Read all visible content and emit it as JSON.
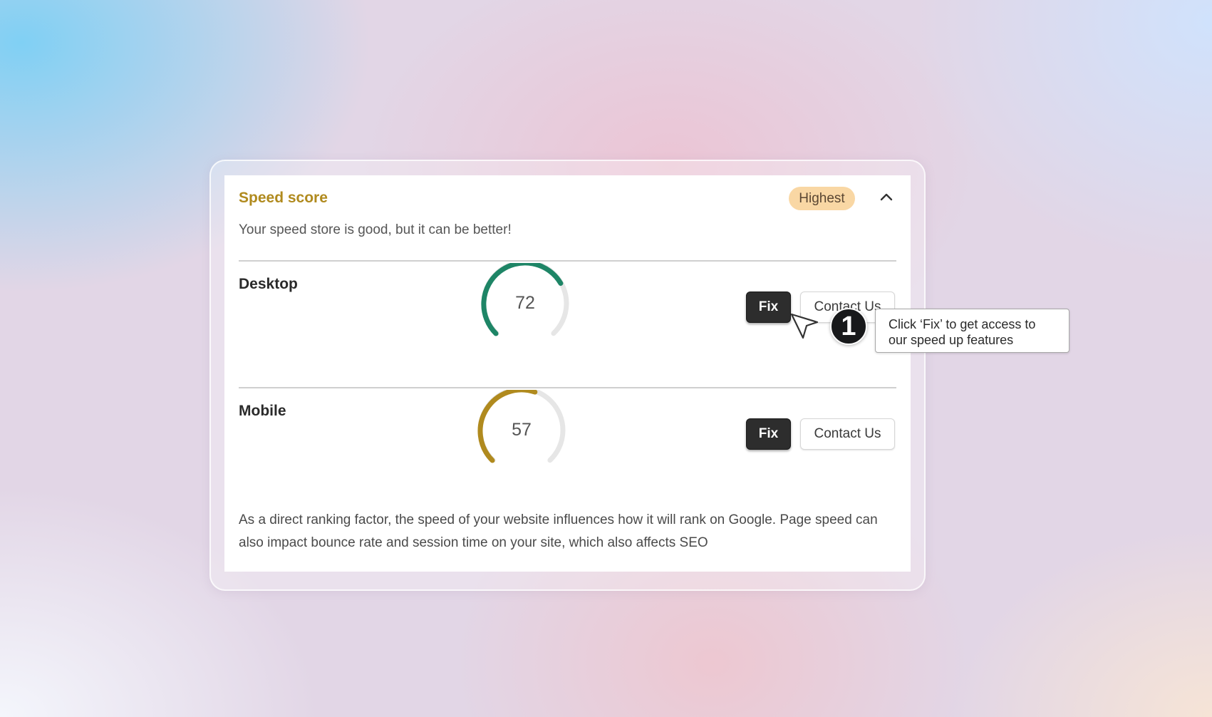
{
  "card": {
    "title": "Speed score",
    "badge": "Highest",
    "subtitle": "Your speed store is good, but it can be better!",
    "footer": "As a direct ranking factor, the speed of your website influences how it will rank on Google. Page speed can also impact bounce rate and session time on your site, which also affects SEO"
  },
  "rows": [
    {
      "label": "Desktop",
      "score": "72",
      "score_value": 72,
      "color": "#1e8566",
      "fix_label": "Fix",
      "contact_label": "Contact Us"
    },
    {
      "label": "Mobile",
      "score": "57",
      "score_value": 57,
      "color": "#b08a1e",
      "fix_label": "Fix",
      "contact_label": "Contact Us"
    }
  ],
  "tour": {
    "step": "1",
    "tooltip": "Click ‘Fix’ to get access to our speed up features"
  },
  "icons": {
    "collapse": "chevron-up-icon",
    "cursor": "pointer-cursor-icon"
  },
  "colors": {
    "badge_bg": "#f9d7a4",
    "title": "#b08a1e",
    "track": "#e6e6e6"
  }
}
